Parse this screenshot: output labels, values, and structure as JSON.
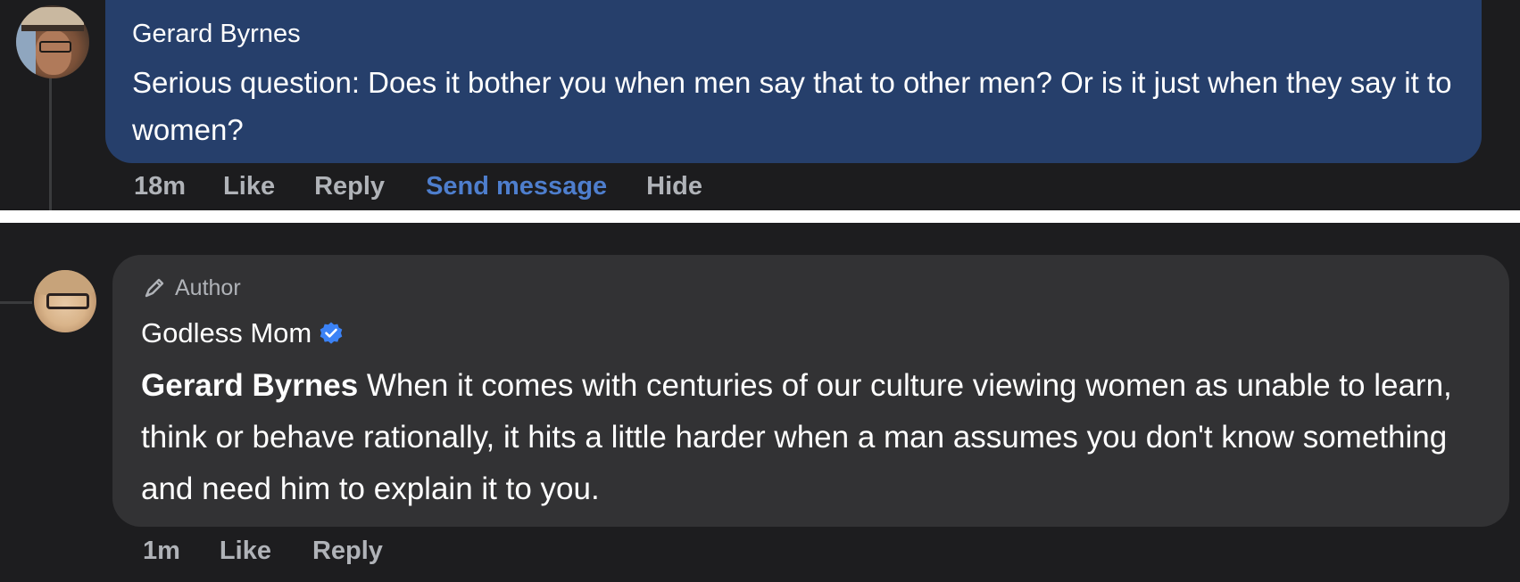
{
  "comment_top": {
    "author": "Gerard Byrnes",
    "text": "Serious question: Does it bother you when men say that to other men? Or is it just when they say it to women?",
    "actions": {
      "time": "18m",
      "like": "Like",
      "reply": "Reply",
      "send_message": "Send message",
      "hide": "Hide"
    },
    "avatar_icon": "user-avatar-icon",
    "bubble_color": "#263f6b"
  },
  "comment_bottom": {
    "badge": "Author",
    "badge_icon": "pencil-icon",
    "author": "Godless Mom",
    "verified_icon": "verified-badge-icon",
    "mention": "Gerard Byrnes",
    "text": " When it comes with centuries of our culture viewing women as unable to learn, think or behave rationally, it hits a little harder when a man assumes you don't know something and need him to explain it to you.",
    "actions": {
      "time": "1m",
      "like": "Like",
      "reply": "Reply"
    },
    "avatar_icon": "user-avatar-icon",
    "bubble_color": "#323234"
  },
  "colors": {
    "link_blue": "#4e7ecd",
    "verified_blue": "#3b82f6",
    "action_gray": "#b0b3b8"
  }
}
